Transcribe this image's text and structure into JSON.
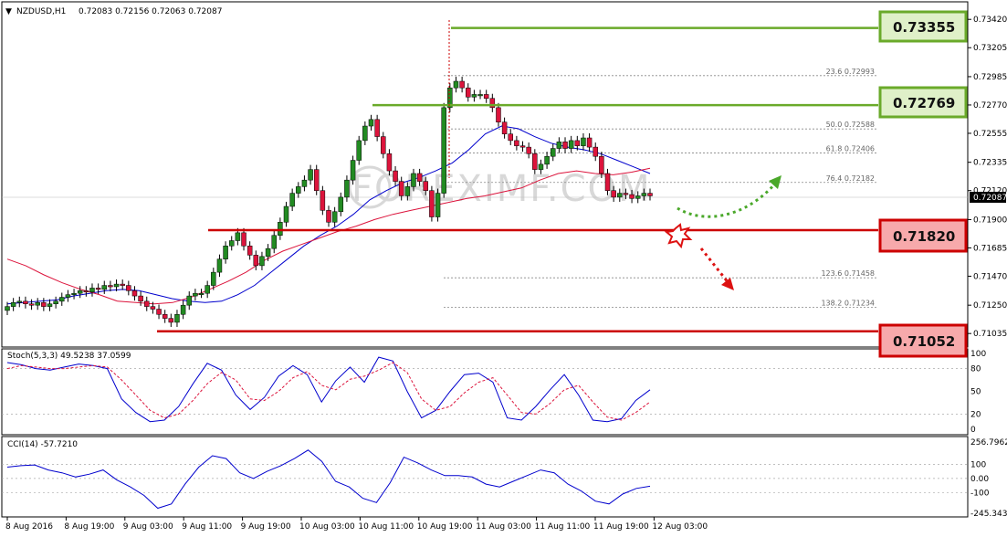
{
  "header": {
    "symbol": "NZDUSD,H1",
    "ohlc": "0.72083 0.72156 0.72063 0.72087"
  },
  "watermark": "FOREXIMF.COM",
  "price_axis": {
    "ticks": [
      "0.73420",
      "0.73205",
      "0.72985",
      "0.72770",
      "0.72555",
      "0.72335",
      "0.72120",
      "0.71900",
      "0.71685",
      "0.71470",
      "0.71250",
      "0.71035"
    ],
    "current_price": "0.72087"
  },
  "time_axis": [
    "8 Aug 2016",
    "8 Aug 19:00",
    "9 Aug 03:00",
    "9 Aug 11:00",
    "9 Aug 19:00",
    "10 Aug 03:00",
    "10 Aug 11:00",
    "10 Aug 19:00",
    "11 Aug 03:00",
    "11 Aug 11:00",
    "11 Aug 19:00",
    "12 Aug 03:00"
  ],
  "levels": [
    {
      "value": "0.73355",
      "type": "resistance"
    },
    {
      "value": "0.72769",
      "type": "resistance"
    },
    {
      "value": "0.71820",
      "type": "support"
    },
    {
      "value": "0.71052",
      "type": "support"
    }
  ],
  "fib_levels": [
    {
      "label": "23.6",
      "value": "0.72993"
    },
    {
      "label": "50.0",
      "value": "0.72588"
    },
    {
      "label": "61.8",
      "value": "0.72406"
    },
    {
      "label": "76.4",
      "value": "0.72182"
    },
    {
      "label": "123.6",
      "value": "0.71458"
    },
    {
      "label": "138.2",
      "value": "0.71234"
    }
  ],
  "stoch": {
    "title": "Stoch(5,3,3) 49.5238 37.0599",
    "ticks": [
      "100",
      "80",
      "50",
      "20",
      "0"
    ]
  },
  "cci": {
    "title": "CCI(14) -57.7210",
    "ticks": [
      "256.7962",
      "100",
      "0.00",
      "-100",
      "-245.3433"
    ]
  },
  "colors": {
    "bull": "#228b22",
    "bear": "#dc143c",
    "ma_fast": "#0000cd",
    "ma_slow": "#dc143c",
    "resistance": "#6aaa2a",
    "support": "#cc0000",
    "up_arrow": "#4aa82a",
    "down_arrow": "#dd1111"
  },
  "chart_data": {
    "type": "line",
    "title": "NZDUSD,H1",
    "xlabel": "",
    "ylabel": "",
    "ylim": [
      0.7096,
      0.7347
    ],
    "x": [
      "8 Aug 2016",
      "8 Aug 19:00",
      "9 Aug 03:00",
      "9 Aug 11:00",
      "9 Aug 19:00",
      "10 Aug 03:00",
      "10 Aug 11:00",
      "10 Aug 19:00",
      "11 Aug 03:00",
      "11 Aug 11:00",
      "11 Aug 19:00",
      "12 Aug 03:00"
    ],
    "closes": [
      0.7124,
      0.7127,
      0.7128,
      0.7126,
      0.7125,
      0.7127,
      0.7124,
      0.7126,
      0.7128,
      0.7131,
      0.7133,
      0.7134,
      0.7136,
      0.7135,
      0.7138,
      0.7137,
      0.714,
      0.7139,
      0.7141,
      0.714,
      0.7136,
      0.7132,
      0.7128,
      0.7124,
      0.7122,
      0.7118,
      0.7115,
      0.7112,
      0.7118,
      0.7125,
      0.7132,
      0.7134,
      0.7134,
      0.714,
      0.715,
      0.716,
      0.717,
      0.7174,
      0.718,
      0.717,
      0.7163,
      0.7155,
      0.7162,
      0.7168,
      0.7178,
      0.7188,
      0.72,
      0.721,
      0.7215,
      0.722,
      0.7228,
      0.7212,
      0.7197,
      0.7188,
      0.7196,
      0.7207,
      0.722,
      0.7235,
      0.725,
      0.7261,
      0.7266,
      0.7253,
      0.724,
      0.7227,
      0.7219,
      0.7208,
      0.7215,
      0.7225,
      0.7219,
      0.7212,
      0.7192,
      0.721,
      0.7275,
      0.729,
      0.7295,
      0.729,
      0.7283,
      0.7285,
      0.7285,
      0.7282,
      0.7275,
      0.7264,
      0.7255,
      0.725,
      0.7246,
      0.7245,
      0.724,
      0.7228,
      0.7232,
      0.7238,
      0.7244,
      0.7249,
      0.7244,
      0.725,
      0.7246,
      0.7252,
      0.7245,
      0.7238,
      0.7225,
      0.7212,
      0.7207,
      0.721,
      0.7209,
      0.7206,
      0.7208,
      0.721,
      0.7208
    ],
    "series": [
      {
        "name": "",
        "type": "sma-fast",
        "values": [
          0.7126,
          0.7127,
          0.7128,
          0.7129,
          0.7132,
          0.7134,
          0.7136,
          0.7137,
          0.7136,
          0.7133,
          0.713,
          0.7128,
          0.7127,
          0.7128,
          0.7133,
          0.714,
          0.715,
          0.716,
          0.717,
          0.7178,
          0.7185,
          0.7194,
          0.7205,
          0.7212,
          0.7218,
          0.7222,
          0.7227,
          0.7233,
          0.7243,
          0.7255,
          0.7261,
          0.7259,
          0.7253,
          0.7248,
          0.7245,
          0.7243,
          0.724,
          0.7235,
          0.723,
          0.7225
        ]
      },
      {
        "name": "",
        "type": "sma-slow",
        "values": [
          0.716,
          0.7155,
          0.7148,
          0.7142,
          0.7137,
          0.7133,
          0.7128,
          0.7127,
          0.7126,
          0.7127,
          0.7131,
          0.7137,
          0.7143,
          0.715,
          0.7159,
          0.7166,
          0.7171,
          0.7176,
          0.7181,
          0.7185,
          0.719,
          0.7194,
          0.7197,
          0.72,
          0.7203,
          0.7206,
          0.7208,
          0.7211,
          0.7214,
          0.722,
          0.7225,
          0.7227,
          0.7225,
          0.7224,
          0.7226,
          0.7229
        ]
      }
    ],
    "stoch": {
      "main": [
        88,
        85,
        80,
        78,
        82,
        86,
        84,
        80,
        40,
        22,
        10,
        12,
        30,
        60,
        87,
        78,
        45,
        26,
        42,
        70,
        84,
        72,
        36,
        64,
        82,
        62,
        95,
        90,
        50,
        15,
        25,
        50,
        72,
        74,
        62,
        15,
        12,
        30,
        52,
        72,
        45,
        12,
        10,
        14,
        38,
        52
      ],
      "signal": [
        80,
        84,
        82,
        80,
        80,
        82,
        84,
        82,
        65,
        45,
        25,
        15,
        20,
        38,
        60,
        75,
        65,
        40,
        38,
        50,
        68,
        76,
        58,
        52,
        66,
        70,
        78,
        88,
        75,
        40,
        25,
        30,
        48,
        62,
        68,
        45,
        22,
        20,
        34,
        52,
        58,
        36,
        16,
        12,
        22,
        36
      ]
    },
    "cci": {
      "values": [
        80,
        90,
        95,
        60,
        40,
        10,
        30,
        60,
        -10,
        -60,
        -120,
        -210,
        -180,
        -40,
        80,
        160,
        140,
        40,
        0,
        50,
        90,
        140,
        200,
        120,
        -20,
        -60,
        -140,
        -170,
        -30,
        150,
        110,
        60,
        20,
        20,
        10,
        -40,
        -60,
        -20,
        20,
        60,
        40,
        -40,
        -90,
        -160,
        -180,
        -110,
        -70,
        -55
      ]
    }
  }
}
